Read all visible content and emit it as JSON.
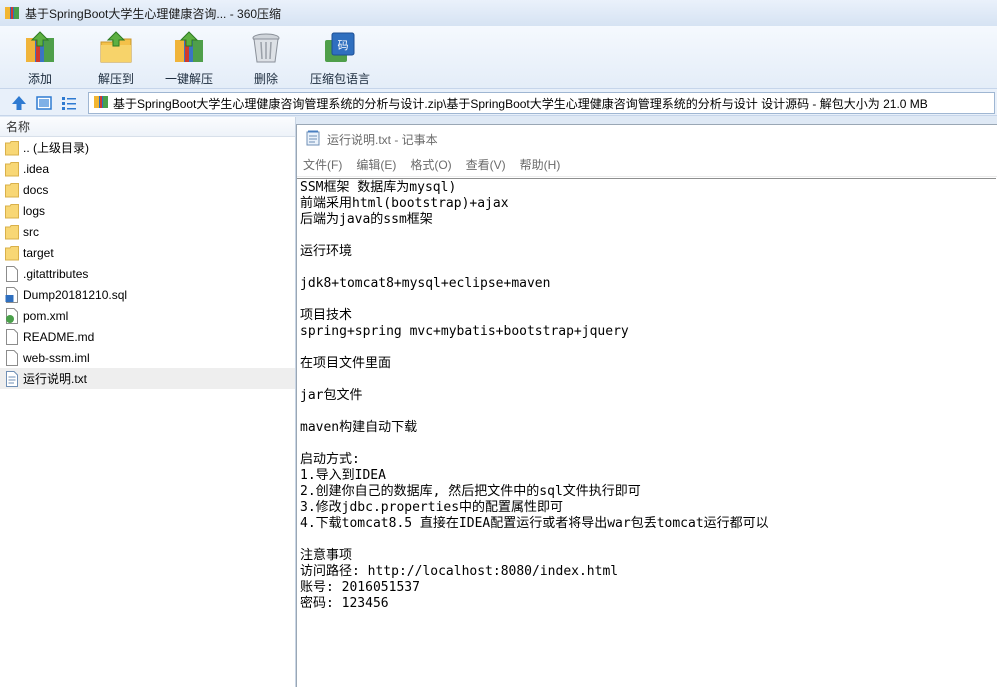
{
  "window": {
    "title": "基于SpringBoot大学生心理健康咨询... - 360压缩"
  },
  "toolbar": {
    "add_label": "添加",
    "extract_label": "解压到",
    "oneclick_label": "一键解压",
    "delete_label": "删除",
    "lang_label": "压缩包语言"
  },
  "address": {
    "path": "基于SpringBoot大学生心理健康咨询管理系统的分析与设计.zip\\基于SpringBoot大学生心理健康咨询管理系统的分析与设计 设计源码 - 解包大小为 21.0 MB"
  },
  "filelist": {
    "header": "名称",
    "items": [
      {
        "name": ".. (上级目录)",
        "type": "folder"
      },
      {
        "name": ".idea",
        "type": "folder"
      },
      {
        "name": "docs",
        "type": "folder"
      },
      {
        "name": "logs",
        "type": "folder"
      },
      {
        "name": "src",
        "type": "folder"
      },
      {
        "name": "target",
        "type": "folder"
      },
      {
        "name": ".gitattributes",
        "type": "file"
      },
      {
        "name": "Dump20181210.sql",
        "type": "sql"
      },
      {
        "name": "pom.xml",
        "type": "xml"
      },
      {
        "name": "README.md",
        "type": "file"
      },
      {
        "name": "web-ssm.iml",
        "type": "file"
      },
      {
        "name": "运行说明.txt",
        "type": "txt",
        "selected": true
      }
    ]
  },
  "notepad": {
    "title": "运行说明.txt - 记事本",
    "menu": [
      "文件(F)",
      "编辑(E)",
      "格式(O)",
      "查看(V)",
      "帮助(H)"
    ],
    "lines": [
      "SSM框架 数据库为mysql)",
      "前端采用html(bootstrap)+ajax",
      "后端为java的ssm框架",
      "",
      "运行环境",
      "",
      "jdk8+tomcat8+mysql+eclipse+maven",
      "",
      "项目技术",
      "spring+spring mvc+mybatis+bootstrap+jquery",
      "",
      "在项目文件里面",
      "",
      "jar包文件",
      "",
      "maven构建自动下载",
      "",
      "启动方式:",
      "1.导入到IDEA",
      "2.创建你自己的数据库, 然后把文件中的sql文件执行即可",
      "3.修改jdbc.properties中的配置属性即可",
      "4.下载tomcat8.5 直接在IDEA配置运行或者将导出war包丢tomcat运行都可以",
      "",
      "注意事项",
      "访问路径: http://localhost:8080/index.html",
      "账号: 2016051537",
      "密码: 123456"
    ]
  }
}
